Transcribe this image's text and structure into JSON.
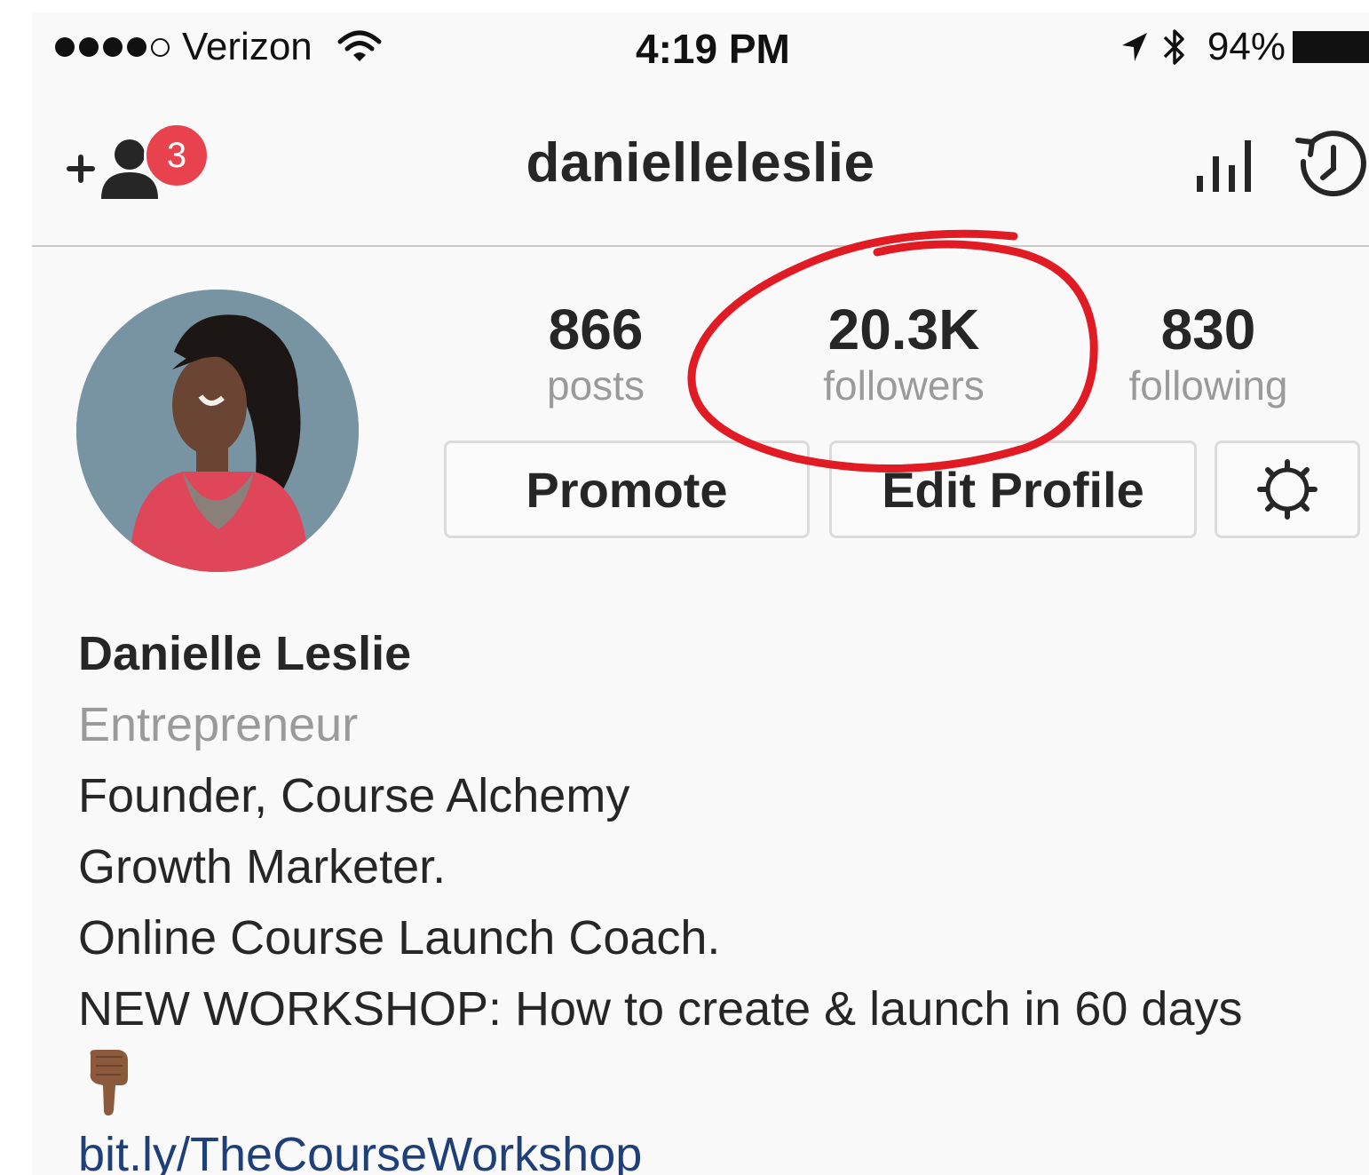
{
  "status_bar": {
    "carrier": "Verizon",
    "time": "4:19 PM",
    "battery": "94%"
  },
  "nav": {
    "username": "danielleleslie",
    "notification_badge": "3",
    "icons": [
      "add-user-icon",
      "insights-icon",
      "history-icon"
    ]
  },
  "profile": {
    "stats": {
      "posts_count": "866",
      "posts_label": "posts",
      "followers_count": "20.3K",
      "followers_label": "followers",
      "following_count": "830",
      "following_label": "following"
    },
    "buttons": {
      "promote": "Promote",
      "edit_profile": "Edit Profile",
      "settings_icon": "gear-icon"
    },
    "annotation_color": "#e01b24",
    "bio": {
      "name": "Danielle Leslie",
      "category": "Entrepreneur",
      "lines": [
        "Founder, Course Alchemy",
        "Growth Marketer.",
        "Online Course Launch Coach.",
        "NEW WORKSHOP: How to create & launch in 60 days"
      ],
      "emoji": "👇🏾",
      "link": "bit.ly/TheCourseWorkshop"
    }
  },
  "colors": {
    "badge": "#e8424f",
    "link": "#1e3f78",
    "muted": "#9a9a9a"
  }
}
